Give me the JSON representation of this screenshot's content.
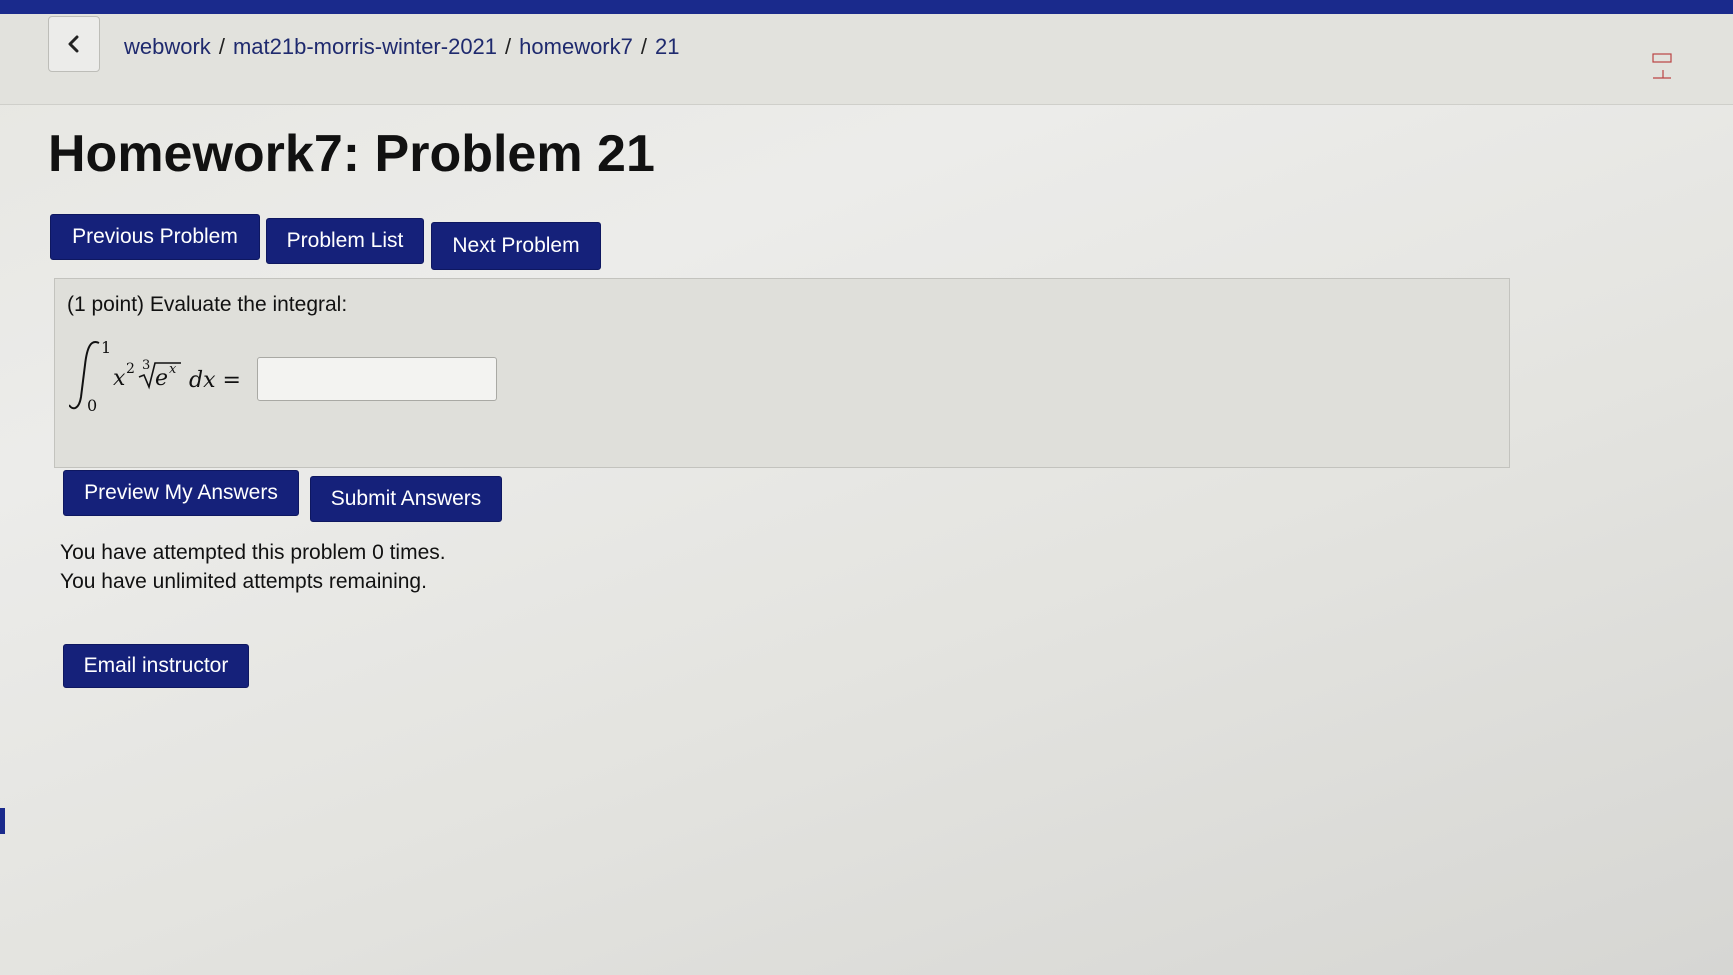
{
  "breadcrumb": {
    "items": [
      "webwork",
      "mat21b-morris-winter-2021",
      "homework7",
      "21"
    ],
    "separator": "/"
  },
  "page": {
    "title": "Homework7: Problem 21"
  },
  "nav": {
    "previous_label": "Previous Problem",
    "list_label": "Problem List",
    "next_label": "Next Problem"
  },
  "problem": {
    "prompt": "(1 point) Evaluate the integral:",
    "integral": {
      "lower_limit": "0",
      "upper_limit": "1",
      "integrand_power": "2",
      "root_index": "3",
      "radicand_exp": "x",
      "equals": "dx ="
    },
    "answer_value": "",
    "answer_placeholder": ""
  },
  "actions": {
    "preview_label": "Preview My Answers",
    "submit_label": "Submit Answers",
    "email_label": "Email instructor"
  },
  "status": {
    "attempts_line": "You have attempted this problem 0 times.",
    "remaining_line": "You have unlimited attempts remaining."
  },
  "colors": {
    "accent": "#15217a",
    "top_bar": "#1a2a8c",
    "background": "#e6e6e1"
  },
  "icons": {
    "back": "chevron-left-icon"
  }
}
